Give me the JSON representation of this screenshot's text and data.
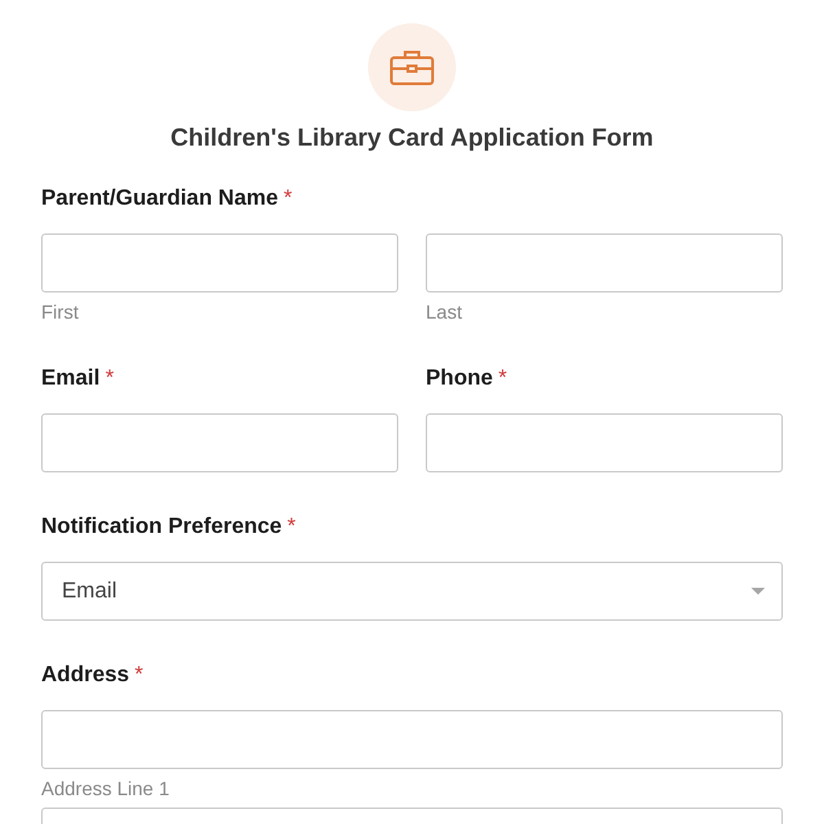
{
  "header": {
    "title": "Children's Library Card Application Form"
  },
  "fields": [
    {
      "kind": "pair",
      "label": "Parent/Guardian Name",
      "required_mark": "*",
      "inputs": [
        {
          "kind": "text",
          "sublabel": "First"
        },
        {
          "kind": "text",
          "sublabel": "Last"
        }
      ]
    },
    {
      "kind": "split",
      "columns": [
        {
          "label": "Email",
          "required_mark": "*"
        },
        {
          "label": "Phone",
          "required_mark": "*"
        }
      ]
    },
    {
      "kind": "select",
      "label": "Notification Preference",
      "required_mark": "*",
      "value": "Email"
    },
    {
      "kind": "stack",
      "label": "Address",
      "required_mark": "*",
      "inputs": [
        {
          "kind": "text",
          "sublabel": "Address Line 1"
        },
        {
          "kind": "text"
        }
      ]
    }
  ]
}
